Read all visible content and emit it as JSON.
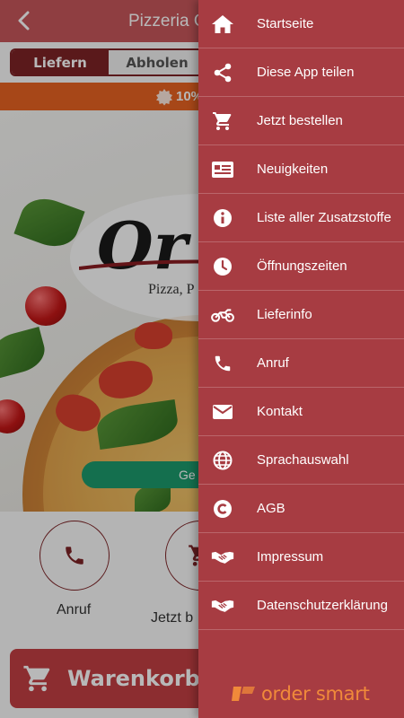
{
  "header": {
    "title": "Pizzeria O",
    "back_icon": "arrow-left-icon"
  },
  "order_mode": {
    "deliver_label": "Liefern",
    "pickup_label": "Abholen",
    "selected": "Liefern"
  },
  "promo": {
    "text": "10%",
    "icon": "discount-badge-icon"
  },
  "hero": {
    "logo_script": "Or",
    "logo_subtitle": "Pizza, P",
    "locate_button_label": "Ge"
  },
  "actions": [
    {
      "label": "Anruf",
      "icon": "phone-icon"
    },
    {
      "label": "Jetzt b",
      "icon": "cart-icon"
    }
  ],
  "cart": {
    "label": "Warenkorb",
    "icon": "cart-icon"
  },
  "menu": {
    "items": [
      {
        "label": "Startseite",
        "icon": "home-icon"
      },
      {
        "label": "Diese App teilen",
        "icon": "share-icon"
      },
      {
        "label": "Jetzt bestellen",
        "icon": "cart-icon"
      },
      {
        "label": "Neuigkeiten",
        "icon": "news-icon"
      },
      {
        "label": "Liste aller Zusatzstoffe",
        "icon": "info-icon"
      },
      {
        "label": "Öffnungszeiten",
        "icon": "clock-icon"
      },
      {
        "label": "Lieferinfo",
        "icon": "motorcycle-icon"
      },
      {
        "label": "Anruf",
        "icon": "phone-icon"
      },
      {
        "label": "Kontakt",
        "icon": "envelope-icon"
      },
      {
        "label": "Sprachauswahl",
        "icon": "globe-icon"
      },
      {
        "label": "AGB",
        "icon": "copyright-icon"
      },
      {
        "label": "Impressum",
        "icon": "handshake-icon"
      },
      {
        "label": "Datenschutzerklärung",
        "icon": "handshake-icon"
      }
    ],
    "brand": "order smart"
  },
  "colors": {
    "header": "#c7575b",
    "drawer": "#a73c42",
    "accent_dark": "#7d2326",
    "promo": "#e86322",
    "cart": "#c23f43",
    "brand": "#f08a3a",
    "locate": "#1d9a6c"
  }
}
